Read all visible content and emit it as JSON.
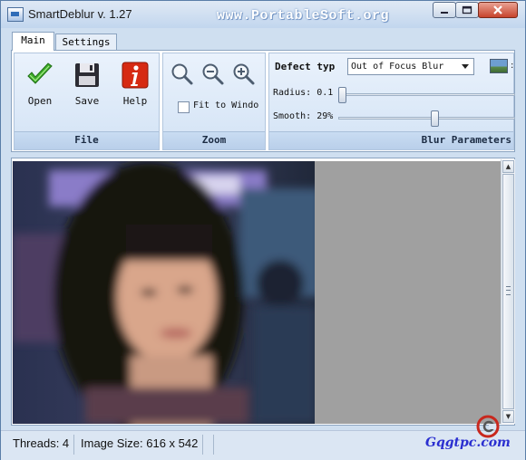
{
  "window": {
    "title": "SmartDeblur v. 1.27",
    "brand_text": "www.PortableSoft.org",
    "controls": [
      "minimize",
      "maximize",
      "close"
    ]
  },
  "tabs": [
    {
      "label": "Main",
      "active": true
    },
    {
      "label": "Settings",
      "active": false
    }
  ],
  "ribbon": {
    "file_group": {
      "label": "File",
      "buttons": [
        {
          "label": "Open",
          "icon": "open-check-icon"
        },
        {
          "label": "Save",
          "icon": "floppy-disk-icon"
        },
        {
          "label": "Help",
          "icon": "help-info-icon"
        }
      ]
    },
    "zoom_group": {
      "label": "Zoom",
      "icons": [
        "zoom-fit-icon",
        "zoom-out-icon",
        "zoom-in-icon"
      ],
      "fit_checkbox": {
        "label": "Fit to Windo",
        "checked": false
      }
    },
    "blur_group": {
      "label": "Blur Parameters",
      "defect_label": "Defect typ",
      "defect_value": "Out of Focus Blur",
      "radius_label": "Radius:",
      "radius_value": "0.1",
      "radius_level": 0.0,
      "smooth_label": "Smooth:",
      "smooth_value": "29%",
      "smooth_level": 0.55,
      "thumbnail_icon": "image-thumbnail-icon"
    }
  },
  "canvas": {
    "image_description_icon": "photo-preview"
  },
  "status": {
    "threads": "Threads: 4",
    "image_size": "Image Size: 616 x 542"
  },
  "watermark": {
    "text": "Gqgtpc.com"
  },
  "colors": {
    "title_bar": "#c2d6ee",
    "ribbon_bg": "#d3e3f5",
    "close_button": "#c7432c",
    "canvas_grey": "#a0a0a0",
    "watermark": "#2a2fd0"
  }
}
